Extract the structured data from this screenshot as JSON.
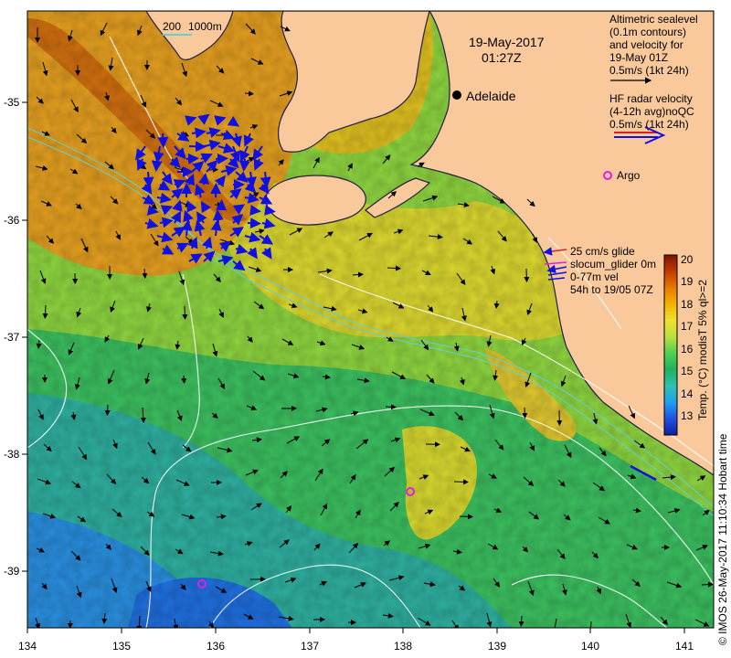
{
  "date_label": "19-May-2017",
  "time_label": "01:27Z",
  "city_label": "Adelaide",
  "argo_label": "Argo",
  "depth_legend": {
    "d1": "200",
    "d2": "1000m"
  },
  "sealevel_legend": [
    "Altimetric sealevel",
    "(0.1m contours)",
    "and velocity for",
    "19-May 01Z",
    "0.5m/s (1kt 24h)"
  ],
  "radar_legend": [
    "HF radar velocity",
    "(4-12h avg)noQC",
    "0.5m/s (1kt 24h)"
  ],
  "glider_legend": [
    "25 cm/s glide",
    "slocum_glider 0m",
    "0-77m vel",
    "54h to 19/05 07Z"
  ],
  "colorbar": {
    "title": "Temp. (°C) modisT 5% ql>=2",
    "ticks": [
      "20",
      "19",
      "18",
      "17",
      "16",
      "15",
      "14",
      "13"
    ],
    "stops": [
      "#7a1400",
      "#c23a00",
      "#e77a00",
      "#f2b400",
      "#f0e030",
      "#b8e040",
      "#50d050",
      "#20b060",
      "#30c0b0",
      "#20a0f0",
      "#2050e0",
      "#1020a0"
    ]
  },
  "credit": "© IMOS 26-May-2017 11:10:34 Hobart time",
  "x_ticks": [
    "134",
    "135",
    "136",
    "137",
    "138",
    "139",
    "140",
    "141"
  ],
  "y_ticks": [
    "-35",
    "-36",
    "-37",
    "-38",
    "-39"
  ],
  "colors": {
    "land": "#f9c99c",
    "contour": "#ffffff",
    "isobath": "#60d0d0",
    "radar": "#1010e0",
    "argo": "#e020e0"
  }
}
